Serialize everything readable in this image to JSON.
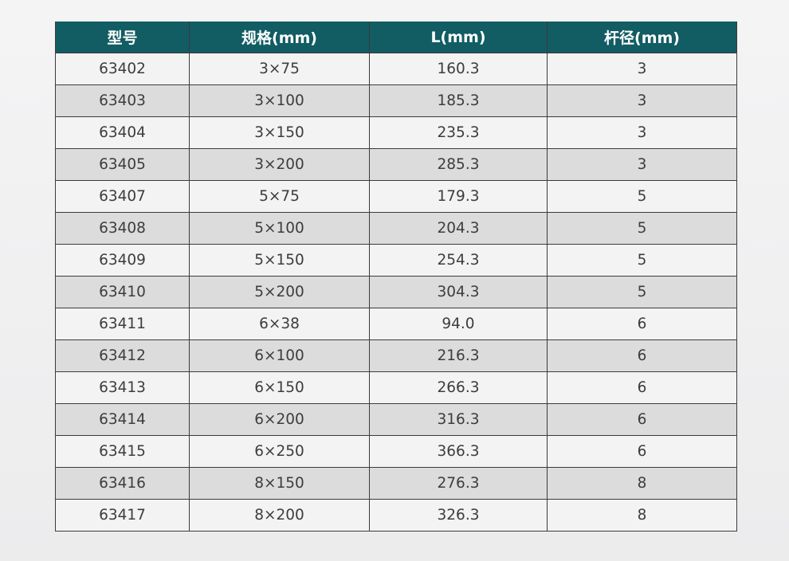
{
  "table": {
    "headers": [
      "型号",
      "规格(mm)",
      "L(mm)",
      "杆径(mm)"
    ],
    "rows": [
      [
        "63402",
        "3×75",
        "160.3",
        "3"
      ],
      [
        "63403",
        "3×100",
        "185.3",
        "3"
      ],
      [
        "63404",
        "3×150",
        "235.3",
        "3"
      ],
      [
        "63405",
        "3×200",
        "285.3",
        "3"
      ],
      [
        "63407",
        "5×75",
        "179.3",
        "5"
      ],
      [
        "63408",
        "5×100",
        "204.3",
        "5"
      ],
      [
        "63409",
        "5×150",
        "254.3",
        "5"
      ],
      [
        "63410",
        "5×200",
        "304.3",
        "5"
      ],
      [
        "63411",
        "6×38",
        "94.0",
        "6"
      ],
      [
        "63412",
        "6×100",
        "216.3",
        "6"
      ],
      [
        "63413",
        "6×150",
        "266.3",
        "6"
      ],
      [
        "63414",
        "6×200",
        "316.3",
        "6"
      ],
      [
        "63415",
        "6×250",
        "366.3",
        "6"
      ],
      [
        "63416",
        "8×150",
        "276.3",
        "8"
      ],
      [
        "63417",
        "8×200",
        "326.3",
        "8"
      ]
    ]
  },
  "colors": {
    "header_bg": "#125c63",
    "header_text": "#ffffff",
    "row_light": "#f3f3f4",
    "row_dark": "#dcdcdc",
    "cell_text": "#3d3d3d",
    "border": "#3b3b3b"
  }
}
